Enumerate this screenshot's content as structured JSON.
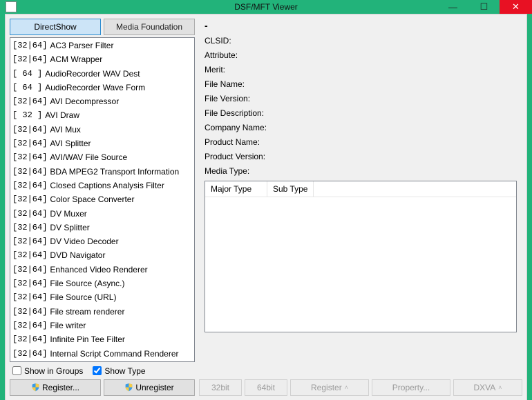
{
  "window": {
    "title": "DSF/MFT Viewer"
  },
  "tabs": {
    "directshow": "DirectShow",
    "mediafoundation": "Media Foundation"
  },
  "filters": [
    {
      "bits": "[32|64]",
      "name": "AC3 Parser Filter"
    },
    {
      "bits": "[32|64]",
      "name": "ACM Wrapper"
    },
    {
      "bits": "[  64 ]",
      "name": "AudioRecorder WAV Dest"
    },
    {
      "bits": "[  64 ]",
      "name": "AudioRecorder Wave Form"
    },
    {
      "bits": "[32|64]",
      "name": "AVI Decompressor"
    },
    {
      "bits": "[  32  ]",
      "name": "AVI Draw"
    },
    {
      "bits": "[32|64]",
      "name": "AVI Mux"
    },
    {
      "bits": "[32|64]",
      "name": "AVI Splitter"
    },
    {
      "bits": "[32|64]",
      "name": "AVI/WAV File Source"
    },
    {
      "bits": "[32|64]",
      "name": "BDA MPEG2 Transport Information"
    },
    {
      "bits": "[32|64]",
      "name": "Closed Captions Analysis Filter"
    },
    {
      "bits": "[32|64]",
      "name": "Color Space Converter"
    },
    {
      "bits": "[32|64]",
      "name": "DV Muxer"
    },
    {
      "bits": "[32|64]",
      "name": "DV Splitter"
    },
    {
      "bits": "[32|64]",
      "name": "DV Video Decoder"
    },
    {
      "bits": "[32|64]",
      "name": "DVD Navigator"
    },
    {
      "bits": "[32|64]",
      "name": "Enhanced Video Renderer"
    },
    {
      "bits": "[32|64]",
      "name": "File Source (Async.)"
    },
    {
      "bits": "[32|64]",
      "name": "File Source (URL)"
    },
    {
      "bits": "[32|64]",
      "name": "File stream renderer"
    },
    {
      "bits": "[32|64]",
      "name": "File writer"
    },
    {
      "bits": "[32|64]",
      "name": "Infinite Pin Tee Filter"
    },
    {
      "bits": "[32|64]",
      "name": "Internal Script Command Renderer"
    }
  ],
  "checkboxes": {
    "show_in_groups": {
      "label": "Show in Groups",
      "checked": false
    },
    "show_type": {
      "label": "Show Type",
      "checked": true
    }
  },
  "left_buttons": {
    "register": "Register...",
    "unregister": "Unregister"
  },
  "details": {
    "dash": "-",
    "labels": {
      "clsid": "CLSID:",
      "attribute": "Attribute:",
      "merit": "Merit:",
      "filename": "File Name:",
      "fileversion": "File Version:",
      "filedescription": "File Description:",
      "companyname": "Company Name:",
      "productname": "Product Name:",
      "productversion": "Product Version:",
      "mediatype": "Media Type:"
    },
    "media_headers": {
      "major": "Major Type",
      "sub": "Sub Type"
    }
  },
  "right_buttons": {
    "b32": "32bit",
    "b64": "64bit",
    "register": "Register",
    "property": "Property...",
    "dxva": "DXVA"
  }
}
